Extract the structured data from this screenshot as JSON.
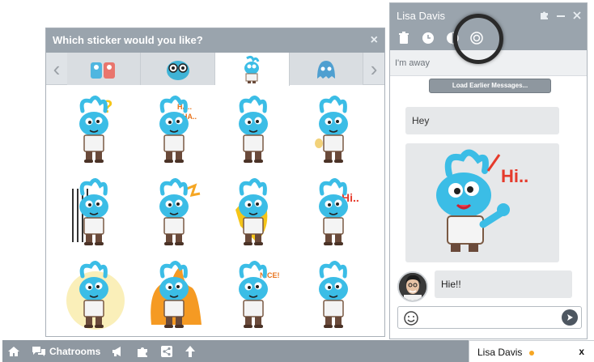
{
  "picker": {
    "title": "Which sticker would you like?",
    "close": "×",
    "tabs": [
      "pack-1",
      "pack-2",
      "pack-3",
      "pack-4"
    ],
    "active_tab": 2
  },
  "stickers": [
    "confused",
    "laughing",
    "thinking",
    "nervous",
    "hiding",
    "angry",
    "rushing",
    "hi",
    "dancing",
    "on-fire",
    "wink",
    "sad"
  ],
  "chat": {
    "contact": "Lisa Davis",
    "status": "I'm away",
    "load_earlier": "Load Earlier Messages...",
    "messages": [
      {
        "from": "me",
        "text": "Hey"
      },
      {
        "from": "me",
        "type": "sticker",
        "caption": "Hi.."
      },
      {
        "from": "them",
        "text": "Hie!!"
      }
    ]
  },
  "bottombar": {
    "chatrooms": "Chatrooms"
  },
  "chat_tab": {
    "name": "Lisa Davis",
    "close": "x"
  },
  "colors": {
    "header_gray": "#9aa4ad",
    "sticker_blue": "#3bbde6",
    "accent_orange": "#f6a623"
  }
}
